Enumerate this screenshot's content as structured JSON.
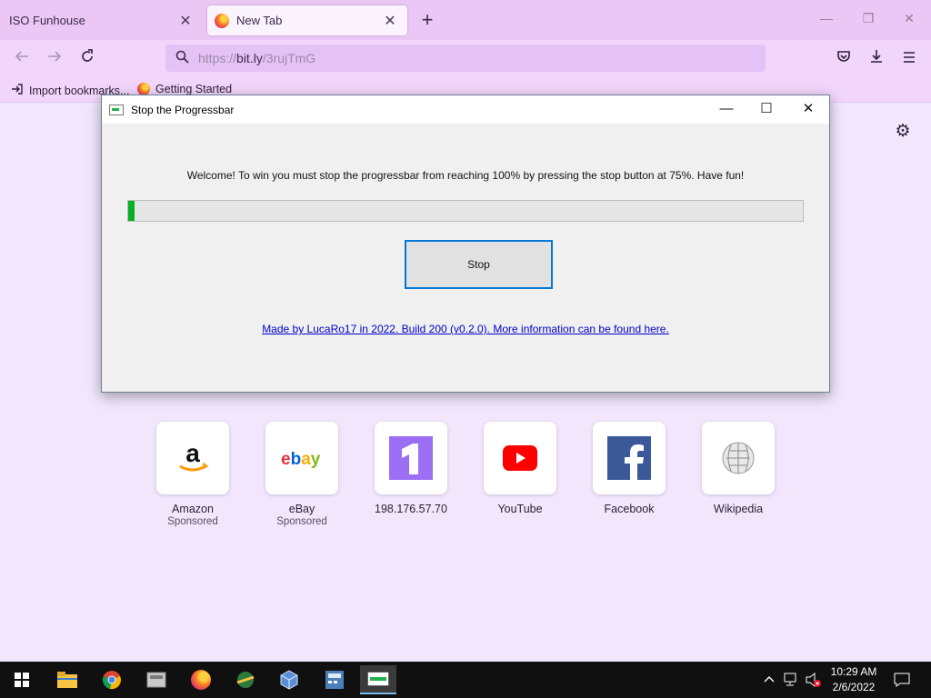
{
  "browser": {
    "tabs": [
      {
        "label": "ISO Funhouse",
        "active": false
      },
      {
        "label": "New Tab",
        "active": true
      }
    ],
    "url": {
      "scheme": "https://",
      "domain": "bit.ly",
      "path": "/3rujTmG"
    },
    "bookmarks": [
      {
        "label": "Import bookmarks...",
        "icon": "import-icon"
      },
      {
        "label": "Getting Started",
        "icon": "firefox-icon"
      }
    ]
  },
  "dialog": {
    "title": "Stop the Progressbar",
    "welcome": "Welcome! To win you must stop the progressbar from reaching 100% by pressing the stop button at 75%. Have fun!",
    "progress_percent": 1,
    "stop_label": "Stop",
    "link": "Made by LucaRo17 in 2022. Build 200 (v0.2.0). More information can be found here."
  },
  "top_sites": [
    {
      "label": "Amazon",
      "sub": "Sponsored",
      "icon": "amazon-icon"
    },
    {
      "label": "eBay",
      "sub": "Sponsored",
      "icon": "ebay-icon"
    },
    {
      "label": "198.176.57.70",
      "sub": "",
      "icon": "site-1-icon"
    },
    {
      "label": "YouTube",
      "sub": "",
      "icon": "youtube-icon"
    },
    {
      "label": "Facebook",
      "sub": "",
      "icon": "facebook-icon"
    },
    {
      "label": "Wikipedia",
      "sub": "",
      "icon": "wikipedia-icon"
    }
  ],
  "taskbar": {
    "time": "10:29 AM",
    "date": "2/6/2022"
  },
  "colors": {
    "progress_fill": "#06b025",
    "focus_border": "#0078d7",
    "tab_strip": "#ebc7f5"
  }
}
